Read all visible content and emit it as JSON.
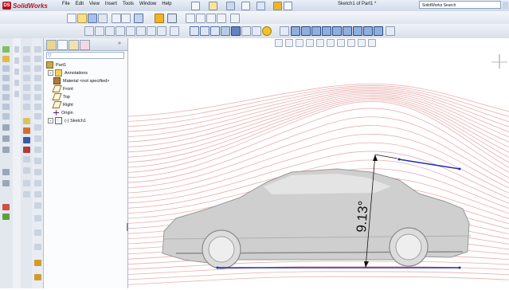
{
  "app": {
    "name": "SolidWorks"
  },
  "menu": [
    "File",
    "Edit",
    "View",
    "Insert",
    "Tools",
    "Window",
    "Help"
  ],
  "window": {
    "title": "Sketch1 of Part1 *"
  },
  "search": {
    "placeholder": "SolidWorks Search"
  },
  "feature_tree": {
    "root": "Part1",
    "items": [
      {
        "label": "Annotations",
        "icon": "annotations-icon",
        "expandable": true
      },
      {
        "label": "Material <not specified>",
        "icon": "material-icon",
        "expandable": false
      },
      {
        "label": "Front",
        "icon": "plane-icon",
        "expandable": false
      },
      {
        "label": "Top",
        "icon": "plane-icon",
        "expandable": false
      },
      {
        "label": "Right",
        "icon": "plane-icon",
        "expandable": false
      },
      {
        "label": "Origin",
        "icon": "origin-icon",
        "expandable": false
      },
      {
        "label": "(-) Sketch1",
        "icon": "sketch-icon",
        "expandable": true
      }
    ]
  },
  "sketch": {
    "angle_dimension": "9.13°"
  },
  "colors": {
    "streamline": "#e5a0a0",
    "sketch_line": "#1c2bb8",
    "accent": "#b5121b"
  }
}
